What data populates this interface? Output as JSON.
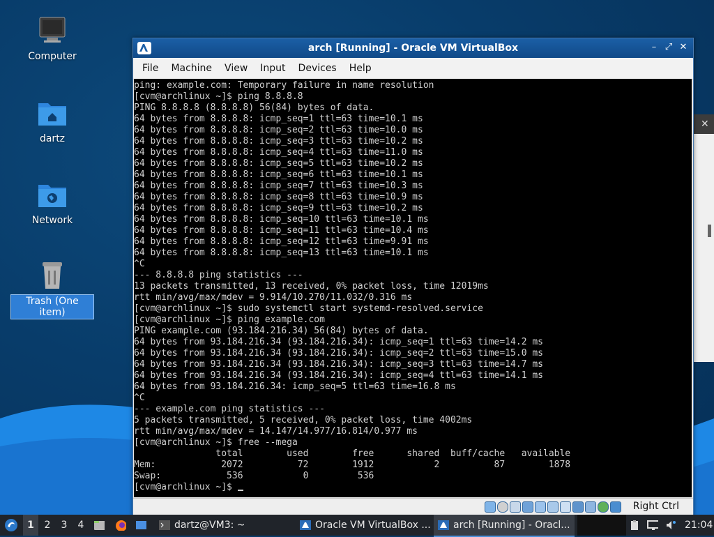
{
  "desktop": {
    "icons": [
      {
        "label": "Computer"
      },
      {
        "label": "dartz"
      },
      {
        "label": "Network"
      },
      {
        "label": "Trash (One item)"
      }
    ]
  },
  "vbox": {
    "title": "arch [Running] - Oracle VM VirtualBox",
    "controls": {
      "minimize": "–",
      "restore": "⤢",
      "close": "✕"
    },
    "menu": [
      "File",
      "Machine",
      "View",
      "Input",
      "Devices",
      "Help"
    ],
    "terminal_lines": [
      "ping: example.com: Temporary failure in name resolution",
      "[cvm@archlinux ~]$ ping 8.8.8.8",
      "PING 8.8.8.8 (8.8.8.8) 56(84) bytes of data.",
      "64 bytes from 8.8.8.8: icmp_seq=1 ttl=63 time=10.1 ms",
      "64 bytes from 8.8.8.8: icmp_seq=2 ttl=63 time=10.0 ms",
      "64 bytes from 8.8.8.8: icmp_seq=3 ttl=63 time=10.2 ms",
      "64 bytes from 8.8.8.8: icmp_seq=4 ttl=63 time=11.0 ms",
      "64 bytes from 8.8.8.8: icmp_seq=5 ttl=63 time=10.2 ms",
      "64 bytes from 8.8.8.8: icmp_seq=6 ttl=63 time=10.1 ms",
      "64 bytes from 8.8.8.8: icmp_seq=7 ttl=63 time=10.3 ms",
      "64 bytes from 8.8.8.8: icmp_seq=8 ttl=63 time=10.9 ms",
      "64 bytes from 8.8.8.8: icmp_seq=9 ttl=63 time=10.2 ms",
      "64 bytes from 8.8.8.8: icmp_seq=10 ttl=63 time=10.1 ms",
      "64 bytes from 8.8.8.8: icmp_seq=11 ttl=63 time=10.4 ms",
      "64 bytes from 8.8.8.8: icmp_seq=12 ttl=63 time=9.91 ms",
      "64 bytes from 8.8.8.8: icmp_seq=13 ttl=63 time=10.1 ms",
      "^C",
      "--- 8.8.8.8 ping statistics ---",
      "13 packets transmitted, 13 received, 0% packet loss, time 12019ms",
      "rtt min/avg/max/mdev = 9.914/10.270/11.032/0.316 ms",
      "[cvm@archlinux ~]$ sudo systemctl start systemd-resolved.service",
      "[cvm@archlinux ~]$ ping example.com",
      "PING example.com (93.184.216.34) 56(84) bytes of data.",
      "64 bytes from 93.184.216.34 (93.184.216.34): icmp_seq=1 ttl=63 time=14.2 ms",
      "64 bytes from 93.184.216.34 (93.184.216.34): icmp_seq=2 ttl=63 time=15.0 ms",
      "64 bytes from 93.184.216.34 (93.184.216.34): icmp_seq=3 ttl=63 time=14.7 ms",
      "64 bytes from 93.184.216.34 (93.184.216.34): icmp_seq=4 ttl=63 time=14.1 ms",
      "64 bytes from 93.184.216.34: icmp_seq=5 ttl=63 time=16.8 ms",
      "^C",
      "--- example.com ping statistics ---",
      "5 packets transmitted, 5 received, 0% packet loss, time 4002ms",
      "rtt min/avg/max/mdev = 14.147/14.977/16.814/0.977 ms",
      "[cvm@archlinux ~]$ free --mega",
      "               total        used        free      shared  buff/cache   available",
      "Mem:            2072          72        1912           2          87        1878",
      "Swap:            536           0         536",
      "[cvm@archlinux ~]$ "
    ],
    "status_host_key": "Right Ctrl"
  },
  "background_window": {
    "close_glyph": "✕"
  },
  "taskbar": {
    "workspaces": [
      "1",
      "2",
      "3",
      "4"
    ],
    "tasks": [
      {
        "label": "dartz@VM3: ~"
      },
      {
        "label": "Oracle VM VirtualBox ..."
      },
      {
        "label": "arch [Running] - Oracl..."
      }
    ],
    "clock": "21:04"
  },
  "colors": {
    "accent": "#2f7fd6",
    "terminal_bg": "#000000",
    "terminal_fg": "#d0d0d0"
  }
}
